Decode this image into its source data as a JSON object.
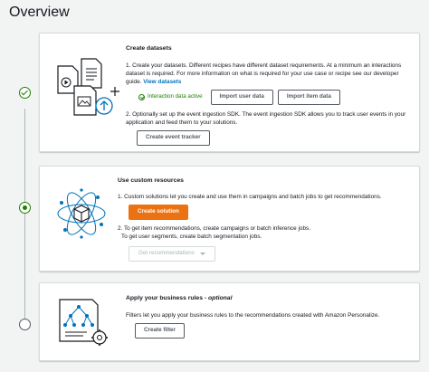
{
  "page": {
    "title": "Overview"
  },
  "steps": [
    {
      "title": "Create datasets",
      "items": [
        "1. Create your datasets. Different recipes have different dataset requirements. At a minimum an interactions dataset is required. For more information on what is required for your use case or recipe see our developer guide.",
        "2. Optionally set up the event ingestion SDK. The event ingestion SDK allows you to track user events in your application and feed them to your solutions."
      ],
      "link_label": "View datasets",
      "status_label": "Interaction data active",
      "buttons": {
        "import_user": "Import user data",
        "import_item": "Import item data",
        "create_tracker": "Create event tracker"
      },
      "state": "complete"
    },
    {
      "title": "Use custom resources",
      "items": [
        "1. Custom solutions let you create and use them in campaigns and batch jobs to get recommendations.",
        "2. To get item recommendations, create campaigns or batch inference jobs.",
        "To get user segments, create batch segmentation jobs."
      ],
      "buttons": {
        "create_solution": "Create solution",
        "get_recommendations": "Get recommendations"
      },
      "state": "current"
    },
    {
      "title": "Apply your business rules - ",
      "title_suffix": "optional",
      "items": [
        "Filters let you apply your business rules to the recommendations created with Amazon Personalize."
      ],
      "buttons": {
        "create_filter": "Create filter"
      },
      "state": "pending"
    }
  ],
  "colors": {
    "primary": "#ec7211",
    "link": "#0073bb",
    "success": "#1d8102",
    "border": "#d5dbdb",
    "background": "#f2f3f3"
  },
  "icons": [
    "dataset-files-illustration",
    "custom-resources-illustration",
    "business-rules-illustration"
  ]
}
